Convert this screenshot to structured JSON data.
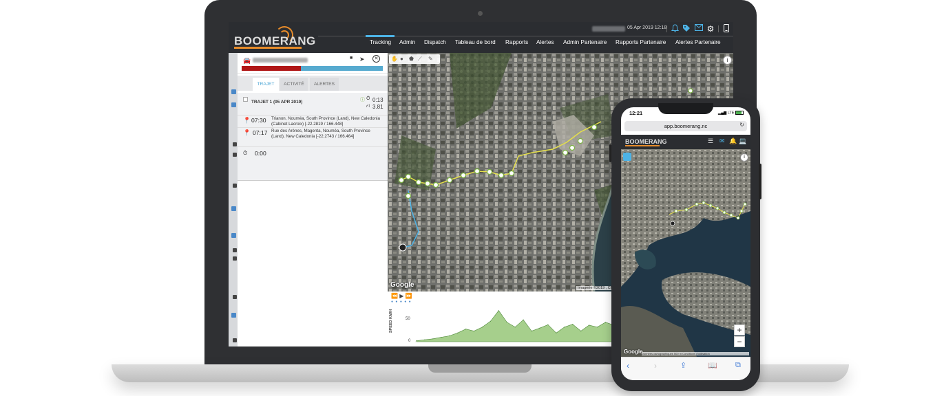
{
  "brand": {
    "name": "BOOMERANG",
    "accent": "#e88c2a",
    "highlight": "#4db3e6",
    "header_bg": "#2b2d31"
  },
  "header": {
    "date": "05 Apr 2019 12:18",
    "icons": [
      "bell-icon",
      "tag-icon",
      "mail-icon",
      "gear-icon",
      "mobile-icon"
    ]
  },
  "nav": {
    "items": [
      "Tracking",
      "Admin",
      "Dispatch",
      "Tableau de bord",
      "Rapports",
      "Alertes",
      "Admin Partenaire",
      "Rapports Partenaire",
      "Alertes Partenaire"
    ],
    "active": "Tracking"
  },
  "panel": {
    "tabs": [
      "TRAJET",
      "ACTIVITÉ",
      "ALERTES"
    ],
    "active_tab": "TRAJET",
    "progress_red_fraction": 0.42,
    "trip": {
      "title": "TRAJET 1 (05 APR 2019)",
      "duration": "0:13",
      "distance": "3.81",
      "stops": [
        {
          "time": "07:30",
          "address": "Trianon, Nouméa, South Province (Land), New Caledonia (Cabinet Lacroix) [-22.2819 / 166.448]",
          "pin_color": "#c0262d"
        },
        {
          "time": "07:17",
          "address": "Rue des Arènes, Magenta, Nouméa, South Province (Land), New Caledonia [-22.2743 / 166.464]",
          "pin_color": "#7cb342"
        },
        {
          "time": "0:00",
          "address": ""
        }
      ]
    }
  },
  "map": {
    "provider": "Google",
    "credit": "Imagerie ©2019 , CNES / Airbus"
  },
  "speed_chart": {
    "ylabel": "SPEED KM/H",
    "y_ticks": [
      "50",
      "0"
    ],
    "ylim": [
      0,
      75
    ],
    "values": [
      2,
      4,
      6,
      9,
      12,
      18,
      26,
      22,
      30,
      42,
      64,
      40,
      30,
      45,
      22,
      28,
      35,
      18,
      30,
      36,
      22,
      34,
      30,
      40,
      34,
      22,
      33,
      26,
      18,
      10,
      6
    ],
    "fill": "#a6cf8c",
    "stroke": "#4f8a3a"
  },
  "phone": {
    "time": "12:21",
    "status": "LTE",
    "url": "app.boomerang.nc",
    "logo": "BOOMERANG",
    "zoom_in": "+",
    "zoom_out": "−",
    "google": "Google",
    "credit": "Données cartographiques   500 m   Conditions d'utilisation",
    "bottom_icons": [
      "back-icon",
      "forward-icon",
      "share-icon",
      "bookmarks-icon",
      "tabs-icon"
    ]
  }
}
